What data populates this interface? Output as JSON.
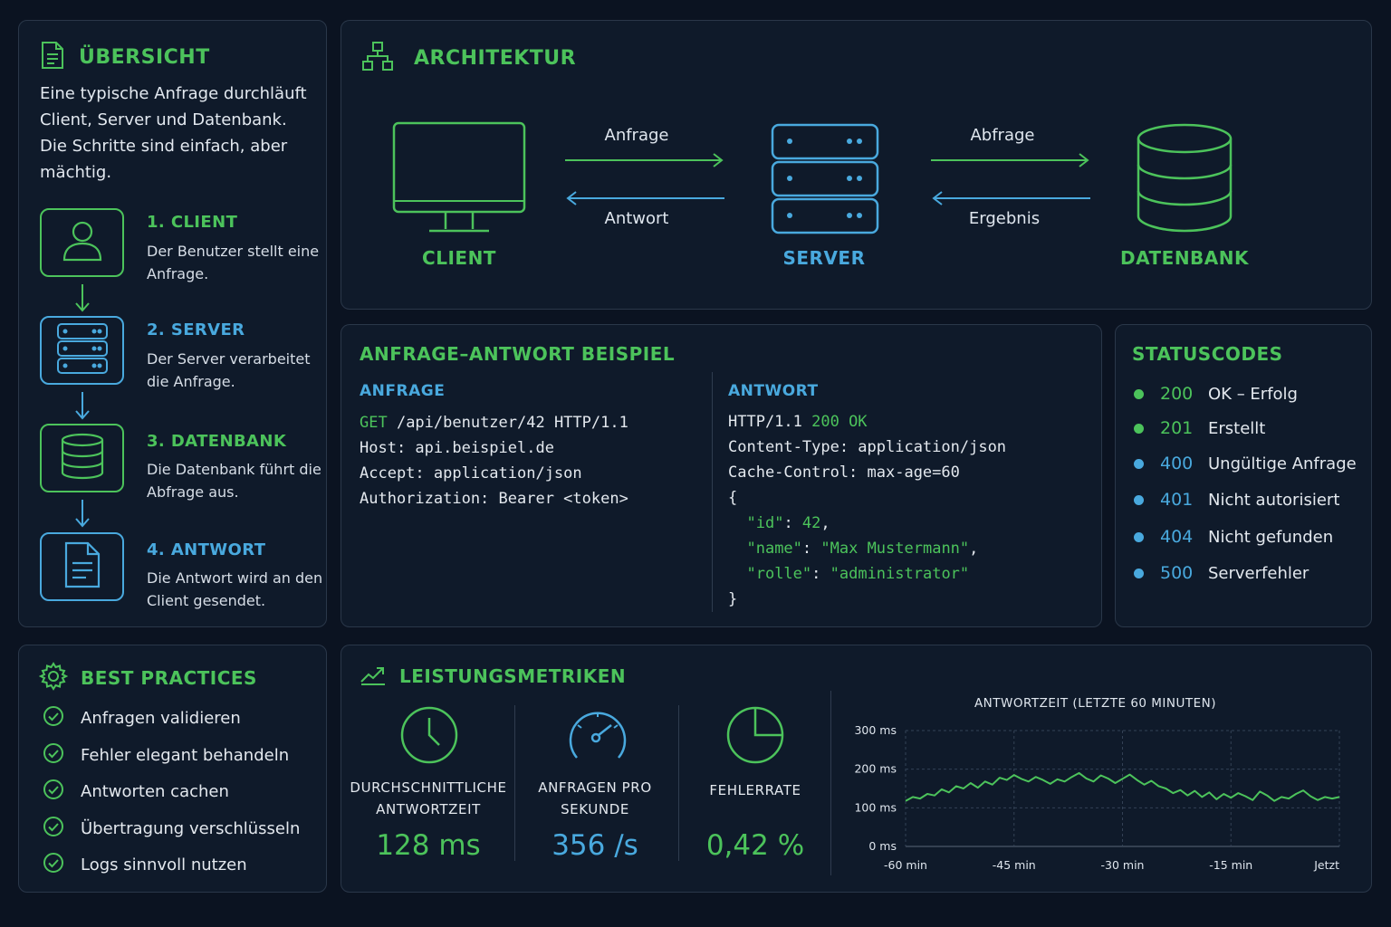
{
  "overview": {
    "title": "ÜBERSICHT",
    "intro": "Eine typische Anfrage durchläuft Client, Server und Datenbank. Die Schritte sind einfach, aber mächtig.",
    "steps": [
      {
        "title": "1. CLIENT",
        "desc": "Der Benutzer stellt eine Anfrage."
      },
      {
        "title": "2. SERVER",
        "desc": "Der Server verarbeitet die Anfrage."
      },
      {
        "title": "3. DATENBANK",
        "desc": "Die Datenbank führt die Abfrage aus."
      },
      {
        "title": "4. ANTWORT",
        "desc": "Die Antwort wird an den Client gesendet."
      }
    ]
  },
  "architecture": {
    "title": "ARCHITEKTUR",
    "nodes": {
      "client": "CLIENT",
      "server": "SERVER",
      "database": "DATENBANK"
    },
    "arrows": {
      "request": "Anfrage",
      "response": "Antwort",
      "query": "Abfrage",
      "result": "Ergebnis"
    }
  },
  "example": {
    "title": "ANFRAGE–ANTWORT BEISPIEL",
    "request": {
      "heading": "ANFRAGE",
      "method": "GET",
      "line1_rest": " /api/benutzer/42 HTTP/1.1",
      "line2": "Host: api.beispiel.de",
      "line3": "Accept: application/json",
      "line4": "Authorization: Bearer <token>"
    },
    "response": {
      "heading": "ANTWORT",
      "status_prefix": "HTTP/1.1 ",
      "status": "200 OK",
      "line2": "Content-Type: application/json",
      "line3": "Cache-Control: max-age=60",
      "brace_open": "{",
      "k_id": "\"id\"",
      "v_id": "42",
      "k_name": "\"name\"",
      "v_name": "\"Max Mustermann\"",
      "k_rolle": "\"rolle\"",
      "v_rolle": "\"administrator\"",
      "brace_close": "}"
    }
  },
  "status": {
    "title": "STATUSCODES",
    "items": [
      {
        "code": "200",
        "text": "OK – Erfolg",
        "color": "#4cc35b"
      },
      {
        "code": "201",
        "text": "Erstellt",
        "color": "#4cc35b"
      },
      {
        "code": "400",
        "text": "Ungültige Anfrage",
        "color": "#49a9de"
      },
      {
        "code": "401",
        "text": "Nicht autorisiert",
        "color": "#49a9de"
      },
      {
        "code": "404",
        "text": "Nicht gefunden",
        "color": "#49a9de"
      },
      {
        "code": "500",
        "text": "Serverfehler",
        "color": "#49a9de"
      }
    ]
  },
  "best_practices": {
    "title": "BEST PRACTICES",
    "items": [
      "Anfragen validieren",
      "Fehler elegant behandeln",
      "Antworten cachen",
      "Übertragung verschlüsseln",
      "Logs sinnvoll nutzen"
    ]
  },
  "metrics": {
    "title": "LEISTUNGSMETRIKEN",
    "cards": [
      {
        "label1": "DURCHSCHNITTLICHE",
        "label2": "ANTWORTZEIT",
        "value": "128 ms"
      },
      {
        "label1": "ANFRAGEN PRO",
        "label2": "SEKUNDE",
        "value": "356 /s"
      },
      {
        "label1": "FEHLERRATE",
        "label2": "",
        "value": "0,42 %"
      }
    ]
  },
  "colors": {
    "green": "#4cc35b",
    "blue": "#49a9de",
    "panel": "#0f1a2a",
    "background": "#0b1321"
  },
  "chart_data": {
    "type": "line",
    "title": "ANTWORTZEIT (LETZTE 60 MINUTEN)",
    "y_ticks": [
      "300 ms",
      "200 ms",
      "100 ms",
      "0 ms"
    ],
    "x_ticks": [
      "-60 min",
      "-45 min",
      "-30 min",
      "-15 min",
      "Jetzt"
    ],
    "xlim": [
      -60,
      0
    ],
    "ylim": [
      0,
      300
    ],
    "grid": true,
    "series": [
      {
        "x": [
          -60,
          -59,
          -58,
          -57,
          -56,
          -55,
          -54,
          -53,
          -52,
          -51,
          -50,
          -49,
          -48,
          -47,
          -46,
          -45,
          -44,
          -43,
          -42,
          -41,
          -40,
          -39,
          -38,
          -37,
          -36,
          -35,
          -34,
          -33,
          -32,
          -31,
          -30,
          -29,
          -28,
          -27,
          -26,
          -25,
          -24,
          -23,
          -22,
          -21,
          -20,
          -19,
          -18,
          -17,
          -16,
          -15,
          -14,
          -13,
          -12,
          -11,
          -10,
          -9,
          -8,
          -7,
          -6,
          -5,
          -4,
          -3,
          -2,
          -1,
          0
        ],
        "values": [
          118,
          128,
          124,
          136,
          132,
          148,
          140,
          156,
          150,
          164,
          152,
          168,
          160,
          178,
          172,
          185,
          175,
          168,
          180,
          172,
          162,
          174,
          168,
          180,
          190,
          176,
          168,
          184,
          176,
          164,
          175,
          186,
          172,
          160,
          170,
          156,
          150,
          138,
          146,
          132,
          144,
          128,
          140,
          122,
          136,
          126,
          138,
          130,
          120,
          142,
          132,
          118,
          128,
          124,
          136,
          145,
          130,
          120,
          128,
          124,
          128
        ]
      }
    ]
  }
}
